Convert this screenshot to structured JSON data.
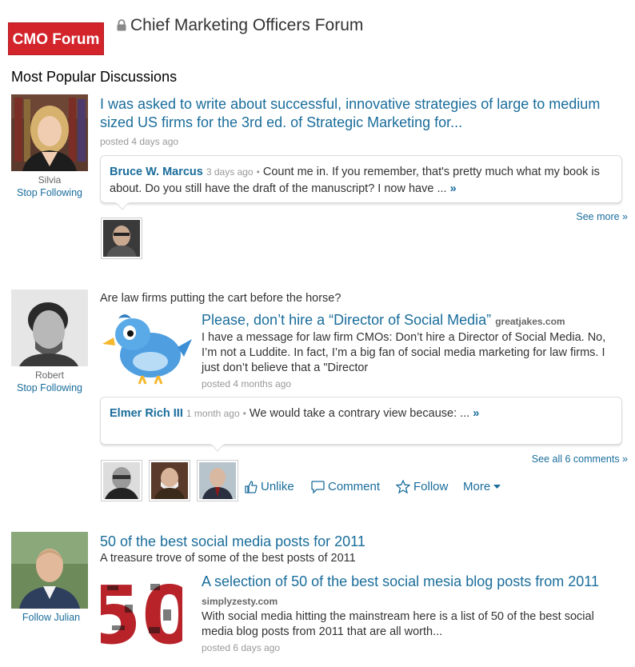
{
  "header": {
    "logo_text": "CMO Forum",
    "group_title": "Chief Marketing Officers Forum",
    "lock_icon": "lock-icon"
  },
  "section_title": "Most Popular Discussions",
  "posts": [
    {
      "poster_name": "Silvia",
      "follow_label": "Stop Following",
      "title": "I was asked to write about successful, innovative strategies of large to medium sized US firms for the 3rd ed. of Strategic Marketing for...",
      "posted": "posted 4 days ago",
      "comment": {
        "author": "Bruce W. Marcus",
        "ago": "3 days ago",
        "separator": "•",
        "text": "Count me in. If you remember, that's pretty much what my book is about. Do you still have the draft of the manuscript? I now have ...",
        "more": "»"
      },
      "see_more": "See more »"
    },
    {
      "poster_name": "Robert",
      "follow_label": "Stop Following",
      "intro": "Are law firms putting the cart before the horse?",
      "link_title": "Please, don’t hire a “Director of Social Media”",
      "link_source": "greatjakes.com",
      "link_desc": "I have a message for law firm CMOs: Don’t hire a Director of Social Media. No, I’m not a Luddite. In fact, I’m a big fan of social media marketing for law firms. I just don’t believe that a \"Director",
      "posted": "posted 4 months ago",
      "comment": {
        "author": "Elmer Rich III",
        "ago": "1 month ago",
        "separator": "•",
        "text": "We would take a contrary view because: ...",
        "more": "»"
      },
      "see_all": "See all 6 comments »",
      "actions": {
        "unlike": "Unlike",
        "comment": "Comment",
        "follow": "Follow",
        "more": "More"
      }
    },
    {
      "follow_label": "Follow Julian",
      "title": "50 of the best social media posts for 2011",
      "subtitle": "A treasure trove of some of the best posts of 2011",
      "link_title": "A selection of 50 of the best social mesia blog posts from 2011",
      "link_source": "simplyzesty.com",
      "link_desc": "With social media hitting the mainstream here is a list of 50 of the best social media blog posts from 2011 that are all worth...",
      "posted": "posted 6 days ago",
      "image_text": "50"
    }
  ],
  "colors": {
    "link": "#1a6d9b",
    "logo_bg": "#d3232b",
    "meta": "#999999"
  }
}
